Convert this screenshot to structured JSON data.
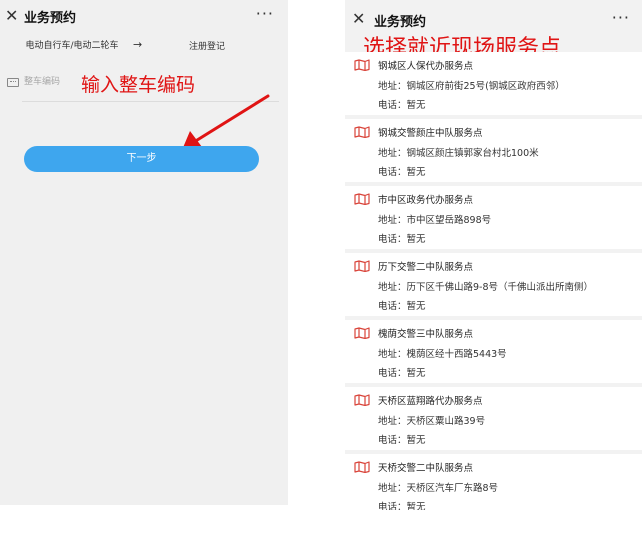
{
  "left_screen": {
    "header": {
      "close_icon": "close-icon",
      "title": "业务预约",
      "more_icon": "more-icon"
    },
    "steps": {
      "current": "电动自行车/电动二轮车",
      "arrow": "→",
      "next": "注册登记"
    },
    "vin_field": {
      "icon": "keyboard-icon",
      "placeholder": "整车编码"
    },
    "annotation": "输入整车编码",
    "next_button": "下一步",
    "colors": {
      "button": "#3ea6ee",
      "annotation": "#e01414"
    }
  },
  "right_screen": {
    "header": {
      "close_icon": "close-icon",
      "title": "业务预约",
      "more_icon": "more-icon"
    },
    "annotation": "选择就近现场服务点",
    "service_points": [
      {
        "icon": "map-icon",
        "name": "钢城区人保代办服务点",
        "address": "地址：钢城区府前街25号(钢城区政府西邻）",
        "phone": "电话：暂无"
      },
      {
        "icon": "map-icon",
        "name": "钢城交警颜庄中队服务点",
        "address": "地址：钢城区颜庄镇郭家台村北100米",
        "phone": "电话：暂无"
      },
      {
        "icon": "map-icon",
        "name": "市中区政务代办服务点",
        "address": "地址：市中区望岳路898号",
        "phone": "电话：暂无"
      },
      {
        "icon": "map-icon",
        "name": "历下交警二中队服务点",
        "address": "地址：历下区千佛山路9-8号（千佛山派出所南侧）",
        "phone": "电话：暂无"
      },
      {
        "icon": "map-icon",
        "name": "槐荫交警三中队服务点",
        "address": "地址：槐荫区经十西路5443号",
        "phone": "电话：暂无"
      },
      {
        "icon": "map-icon",
        "name": "天桥区蓝翔路代办服务点",
        "address": "地址：天桥区粟山路39号",
        "phone": "电话：暂无"
      },
      {
        "icon": "map-icon",
        "name": "天桥交警二中队服务点",
        "address": "地址：天桥区汽车厂东路8号",
        "phone": "电话：暂无"
      }
    ],
    "colors": {
      "map_icon": "#d9443a",
      "annotation": "#e01414"
    }
  }
}
